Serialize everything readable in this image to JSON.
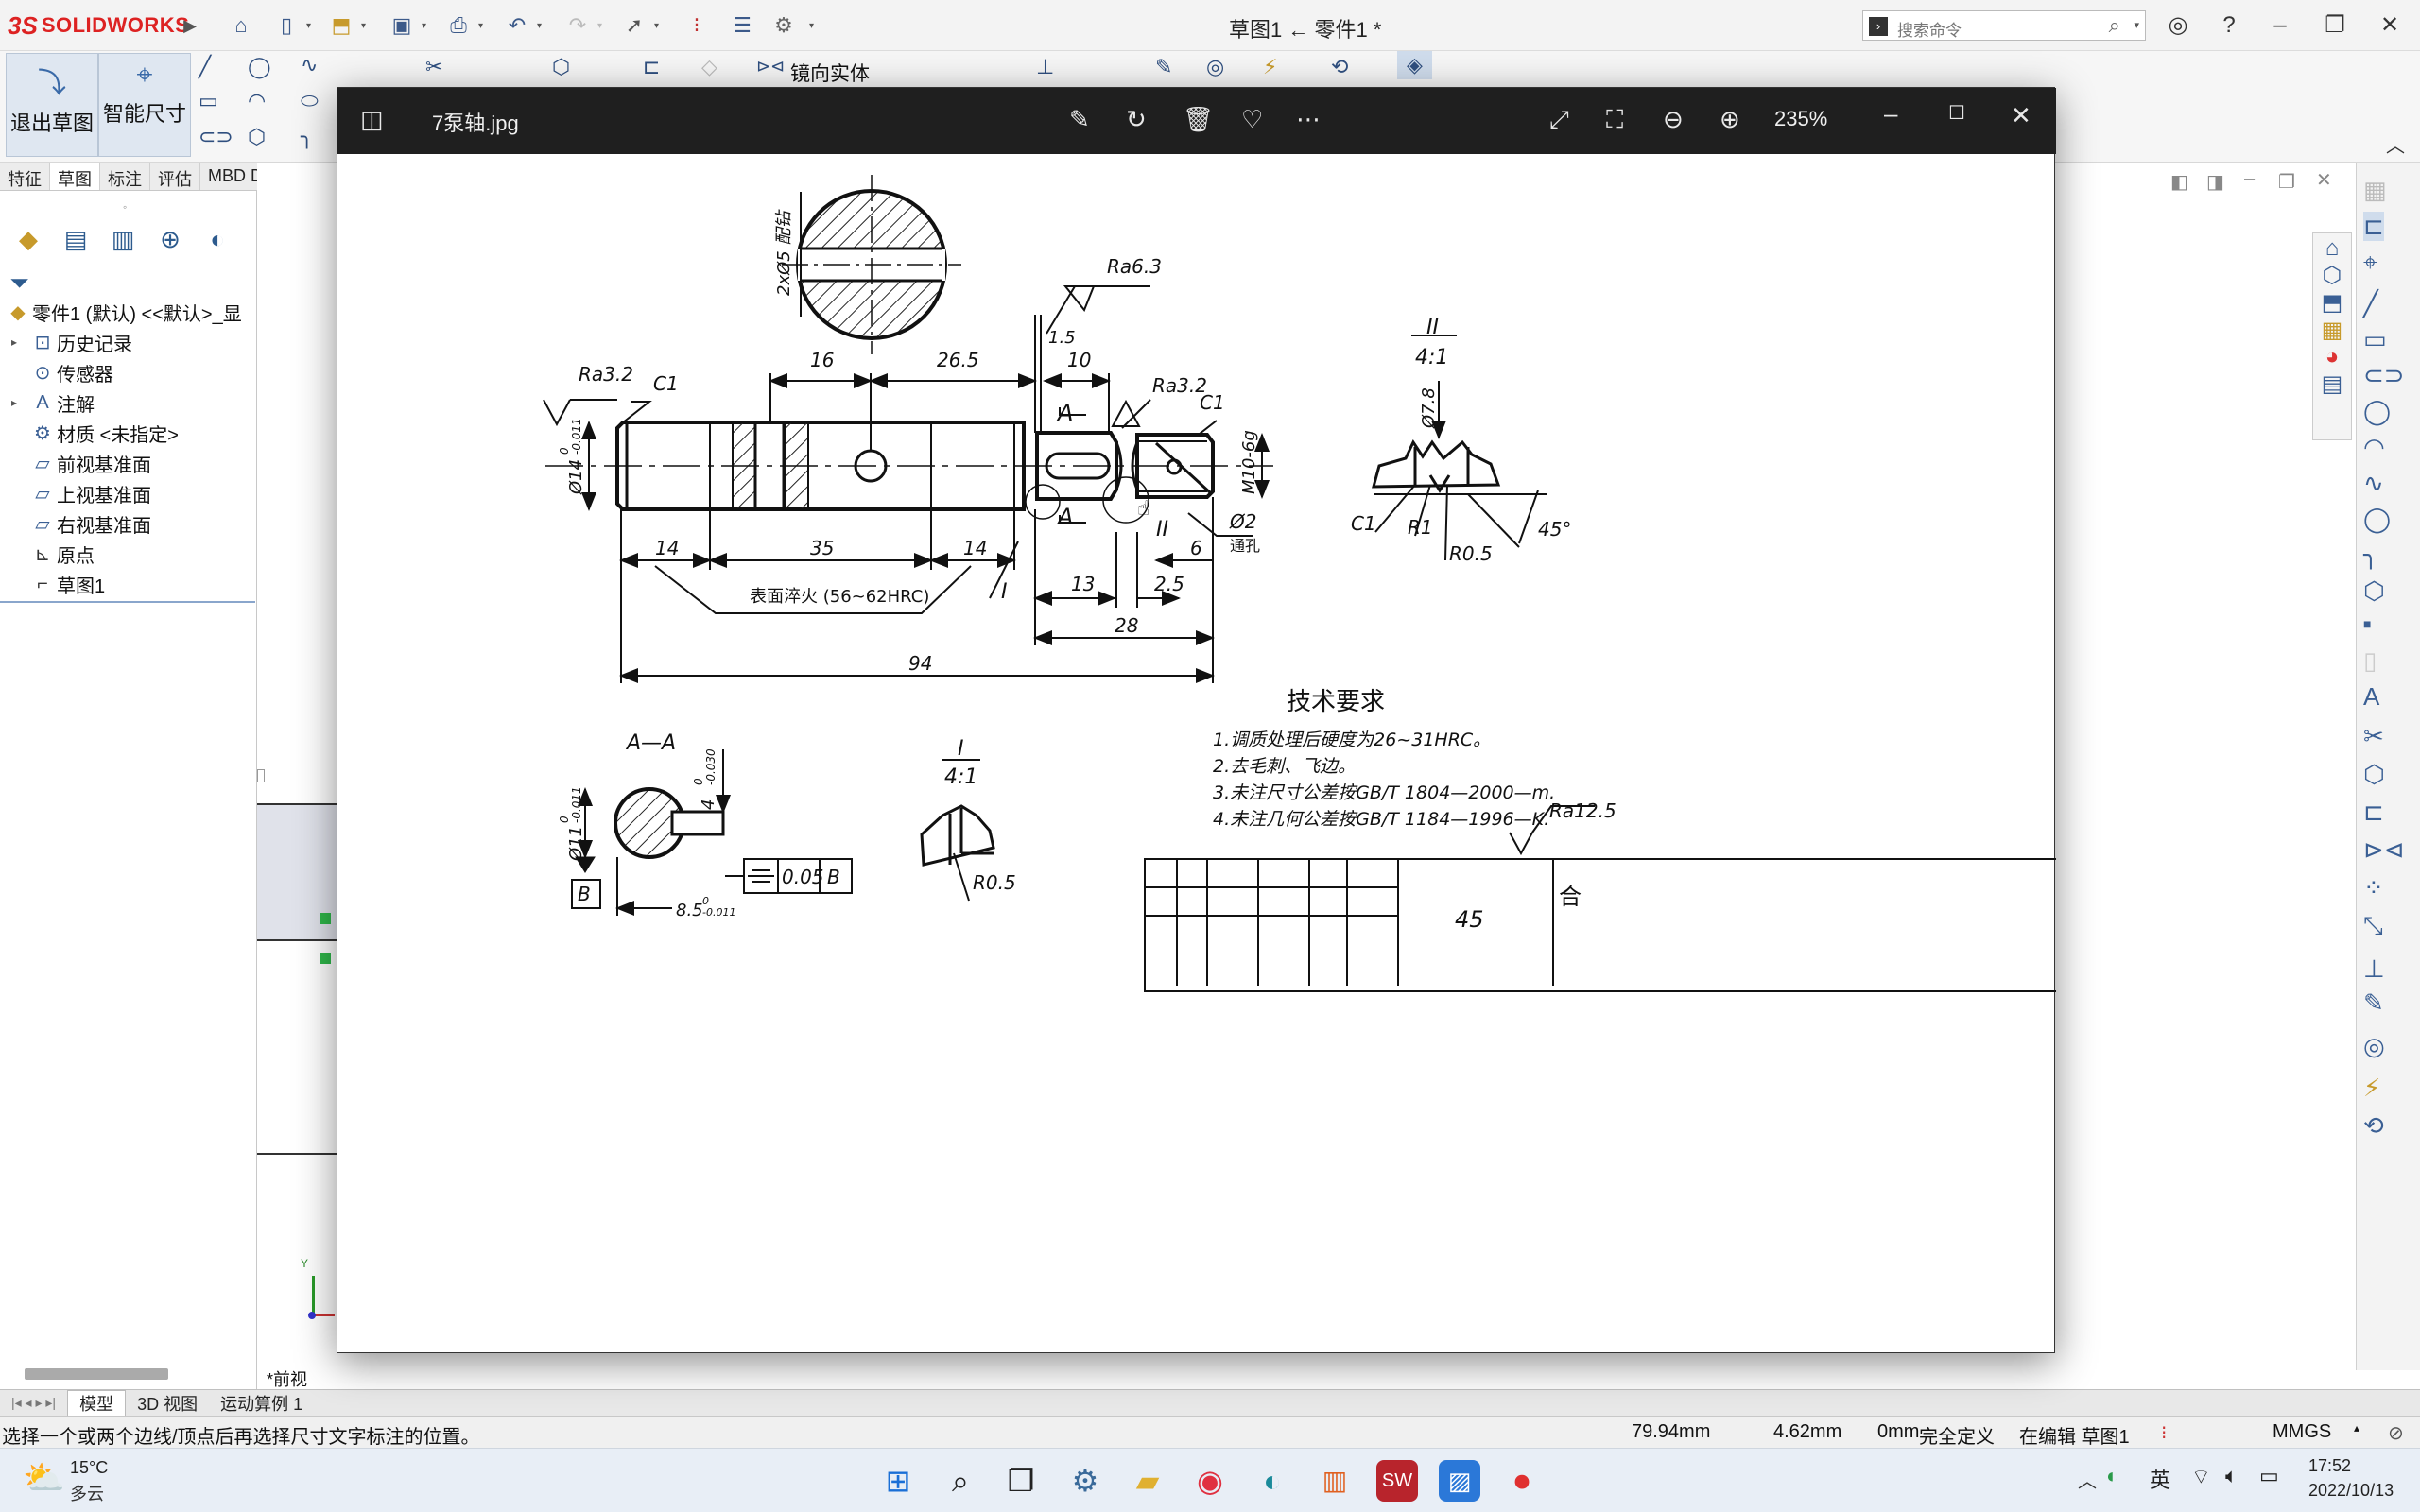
{
  "app": {
    "logo_ds": "3S",
    "logo_text": "SOLIDWORKS",
    "document_title": "草图1 ← 零件1 *",
    "search_placeholder": "搜索命令"
  },
  "command_manager": {
    "exit_sketch": "退出草图",
    "smart_dimension": "智能尺寸",
    "mirror_entities": "镜向实体"
  },
  "tabs": [
    "特征",
    "草图",
    "标注",
    "评估",
    "MBD Dimensio"
  ],
  "feature_tree": {
    "root": "零件1 (默认) <<默认>_显",
    "items": [
      "历史记录",
      "传感器",
      "注解",
      "材质 <未指定>",
      "前视基准面",
      "上视基准面",
      "右视基准面",
      "原点",
      "草图1"
    ]
  },
  "graphics": {
    "view_name": "*前视",
    "triad_y": "Y"
  },
  "model_tabs": [
    "模型",
    "3D 视图",
    "运动算例 1"
  ],
  "status_bar": {
    "message": "选择一个或两个边线/顶点后再选择尺寸文字标注的位置。",
    "x": "79.94mm",
    "y": "4.62mm",
    "z": "0mm",
    "definition": "完全定义",
    "editing": "在编辑 草图1",
    "units": "MMGS"
  },
  "viewer": {
    "filename": "7泵轴.jpg",
    "zoom": "235%"
  },
  "drawing": {
    "labels": {
      "tol_2x5": "2xØ5 配钻",
      "ra63": "Ra6.3",
      "ra32_left": "Ra3.2",
      "ra32_right": "Ra3.2",
      "ra125": "Ra12.5",
      "c1_left": "C1",
      "c1_right": "C1",
      "c1_detail": "C1",
      "d16": "16",
      "d265": "26.5",
      "d15": "1.5",
      "d10": "10",
      "d14a": "14",
      "d35": "35",
      "d14b": "14",
      "d13": "13",
      "d25": "2.5",
      "d6": "6",
      "d28": "28",
      "d94": "94",
      "phi14": "Ø14",
      "phi14_tol": "0\n-0.011",
      "m10": "M10-6g",
      "phi2": "Ø2",
      "through_hole": "通孔",
      "section_a": "A",
      "section_a2": "A",
      "roman_i": "I",
      "roman_ii": "II",
      "hardening": "表面淬火 (56~62HRC)",
      "detail_ii_title": "II",
      "detail_ii_scale": "4:1",
      "phi78": "Ø7.8",
      "r1": "R1",
      "r05_a": "R0.5",
      "deg45": "45°",
      "section_aa": "A—A",
      "phi11": "Ø11",
      "phi11_tol": "0\n-0.011",
      "w4": "4",
      "w4_tol": "0\n-0.030",
      "d85": "8.5",
      "d85_tol": "0\n-0.011",
      "sym_tol": "0.05",
      "datum_b_ref": "B",
      "datum_b": "B",
      "detail_i_title": "I",
      "detail_i_scale": "4:1",
      "r05_b": "R0.5",
      "tech_title": "技术要求",
      "tech_1": "1.调质处理后硬度为26~31HRC。",
      "tech_2": "2.去毛刺、飞边。",
      "tech_3": "3.未注尺寸公差按GB/T 1804—2000—m.",
      "tech_4": "4.未注几何公差按GB/T 1184—1996—K.",
      "title_45": "45",
      "title_he": "合"
    }
  },
  "taskbar": {
    "weather_temp": "15°C",
    "weather_desc": "多云",
    "ime": "英",
    "time": "17:52",
    "date": "2022/10/13"
  }
}
